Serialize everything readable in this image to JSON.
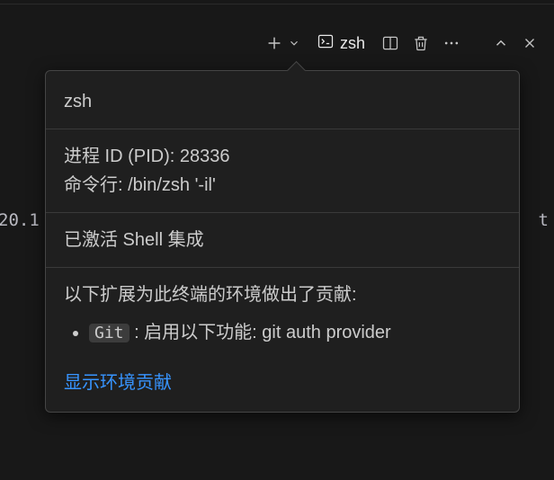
{
  "toolbar": {
    "terminal_tab_label": "zsh"
  },
  "background": {
    "left_fragment": "20.1",
    "right_fragment": "t"
  },
  "popover": {
    "title": "zsh",
    "pid_line": "进程 ID (PID): 28336",
    "cmd_line": "命令行: /bin/zsh '-il'",
    "shell_integration": "已激活 Shell 集成",
    "contrib_heading": "以下扩展为此终端的环境做出了贡献:",
    "contrib_item_name": "Git",
    "contrib_item_rest": " : 启用以下功能: git auth provider",
    "link_label": "显示环境贡献"
  }
}
